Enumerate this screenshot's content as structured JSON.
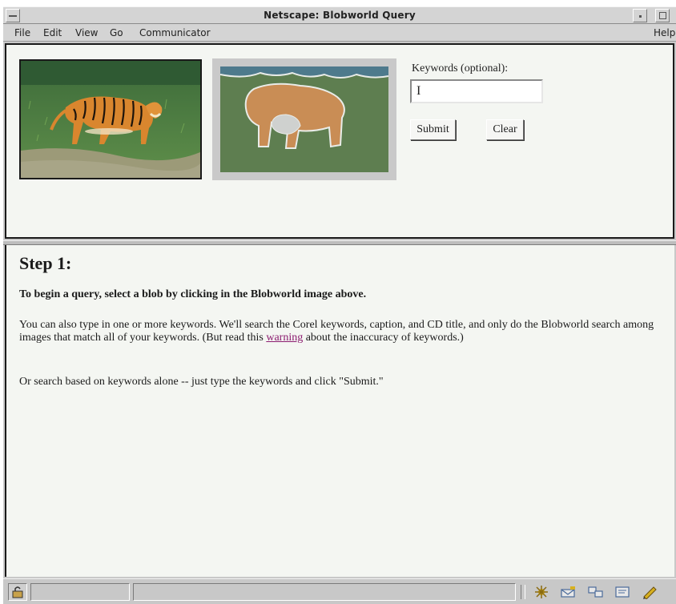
{
  "window": {
    "title": "Netscape: Blobworld Query"
  },
  "menubar": {
    "file": "File",
    "edit": "Edit",
    "view": "View",
    "go": "Go",
    "communicator": "Communicator",
    "help": "Help"
  },
  "query_form": {
    "keywords_label": "Keywords (optional):",
    "keywords_value": "I",
    "submit_label": "Submit",
    "clear_label": "Clear"
  },
  "step": {
    "title": "Step 1:",
    "instruction": "To begin a query, select a blob by clicking in the Blobworld image above.",
    "para1_before_link": "You can also type in one or more keywords. We'll search the Corel keywords, caption, and CD title, and only do the Blobworld search among images that match all of your keywords. (But read this ",
    "para1_link": "warning",
    "para1_after_link": " about the inaccuracy of keywords.)",
    "para2": "Or search based on keywords alone -- just type the keywords and click \"Submit.\""
  },
  "statusbar": {
    "icons": [
      "lock-icon",
      "navigator-icon",
      "mail-icon",
      "discussion-icon",
      "composer-icon",
      "edit-pen-icon"
    ]
  },
  "colors": {
    "page_background": "#f4f6f2",
    "link": "#8b1b6f",
    "blob_green": "#5e7e50",
    "blob_orange": "#c98d55"
  }
}
